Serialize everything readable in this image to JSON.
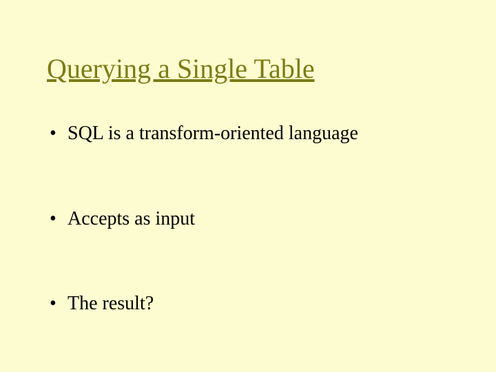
{
  "slide": {
    "title": "Querying a Single Table",
    "bullets": [
      "SQL is a transform-oriented language",
      "Accepts as input",
      "The result?"
    ]
  }
}
